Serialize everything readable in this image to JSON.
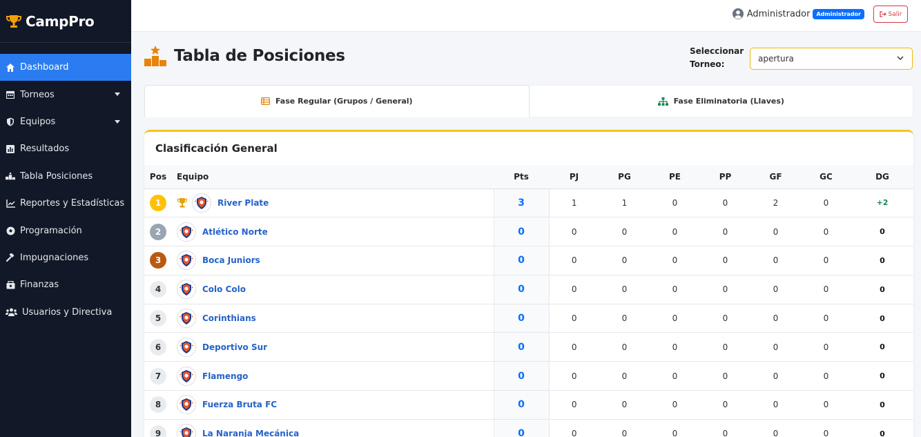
{
  "brand": {
    "name": "CampPro",
    "icon": "trophy-icon"
  },
  "sidebar": {
    "items": [
      {
        "label": "Dashboard",
        "icon": "home-icon",
        "active": true
      },
      {
        "label": "Torneos",
        "icon": "calendar-icon",
        "dropdown": true
      },
      {
        "label": "Equipos",
        "icon": "shield-icon",
        "dropdown": true
      },
      {
        "label": "Resultados",
        "icon": "chart-square-icon"
      },
      {
        "label": "Tabla Posiciones",
        "icon": "podium-icon"
      },
      {
        "label": "Reportes y Estadísticas",
        "icon": "line-chart-icon"
      },
      {
        "label": "Programación",
        "icon": "soccer-ball-icon"
      },
      {
        "label": "Impugnaciones",
        "icon": "gavel-icon"
      },
      {
        "label": "Finanzas",
        "icon": "money-icon"
      },
      {
        "label": "Usuarios y Directiva",
        "icon": "users-icon"
      }
    ]
  },
  "topbar": {
    "user_name": "Administrador",
    "role_badge": "Administrador",
    "logout_label": "Salir"
  },
  "page": {
    "title": "Tabla de Posiciones",
    "select_label_1": "Seleccionar",
    "select_label_2": "Torneo:",
    "selected_tournament": "apertura"
  },
  "tabs": [
    {
      "label": "Fase Regular (Grupos / General)",
      "icon": "table-list-icon",
      "active": true
    },
    {
      "label": "Fase Eliminatoria (Llaves)",
      "icon": "sitemap-icon",
      "active": false
    }
  ],
  "standings": {
    "title": "Clasificación General",
    "columns": {
      "pos": "Pos",
      "team": "Equipo",
      "pts": "Pts",
      "pj": "PJ",
      "pg": "PG",
      "pe": "PE",
      "pp": "PP",
      "gf": "GF",
      "gc": "GC",
      "dg": "DG"
    },
    "rows": [
      {
        "pos": "1",
        "team": "River Plate",
        "pts": "3",
        "pj": "1",
        "pg": "1",
        "pe": "0",
        "pp": "0",
        "gf": "2",
        "gc": "0",
        "dg": "+2"
      },
      {
        "pos": "2",
        "team": "Atlético Norte",
        "pts": "0",
        "pj": "0",
        "pg": "0",
        "pe": "0",
        "pp": "0",
        "gf": "0",
        "gc": "0",
        "dg": "0"
      },
      {
        "pos": "3",
        "team": "Boca Juniors",
        "pts": "0",
        "pj": "0",
        "pg": "0",
        "pe": "0",
        "pp": "0",
        "gf": "0",
        "gc": "0",
        "dg": "0"
      },
      {
        "pos": "4",
        "team": "Colo Colo",
        "pts": "0",
        "pj": "0",
        "pg": "0",
        "pe": "0",
        "pp": "0",
        "gf": "0",
        "gc": "0",
        "dg": "0"
      },
      {
        "pos": "5",
        "team": "Corinthians",
        "pts": "0",
        "pj": "0",
        "pg": "0",
        "pe": "0",
        "pp": "0",
        "gf": "0",
        "gc": "0",
        "dg": "0"
      },
      {
        "pos": "6",
        "team": "Deportivo Sur",
        "pts": "0",
        "pj": "0",
        "pg": "0",
        "pe": "0",
        "pp": "0",
        "gf": "0",
        "gc": "0",
        "dg": "0"
      },
      {
        "pos": "7",
        "team": "Flamengo",
        "pts": "0",
        "pj": "0",
        "pg": "0",
        "pe": "0",
        "pp": "0",
        "gf": "0",
        "gc": "0",
        "dg": "0"
      },
      {
        "pos": "8",
        "team": "Fuerza Bruta FC",
        "pts": "0",
        "pj": "0",
        "pg": "0",
        "pe": "0",
        "pp": "0",
        "gf": "0",
        "gc": "0",
        "dg": "0"
      },
      {
        "pos": "9",
        "team": "La Naranja Mecánica",
        "pts": "0",
        "pj": "0",
        "pg": "0",
        "pe": "0",
        "pp": "0",
        "gf": "0",
        "gc": "0",
        "dg": "0"
      }
    ]
  },
  "colors": {
    "sidebar_bg": "#111827",
    "active": "#2b7cf0",
    "accent": "#f5c518",
    "link": "#2563c9",
    "gold": "#ffc107",
    "silver": "#9aa4b2",
    "bronze": "#b85a12",
    "positive": "#198754",
    "danger": "#dc3545"
  }
}
